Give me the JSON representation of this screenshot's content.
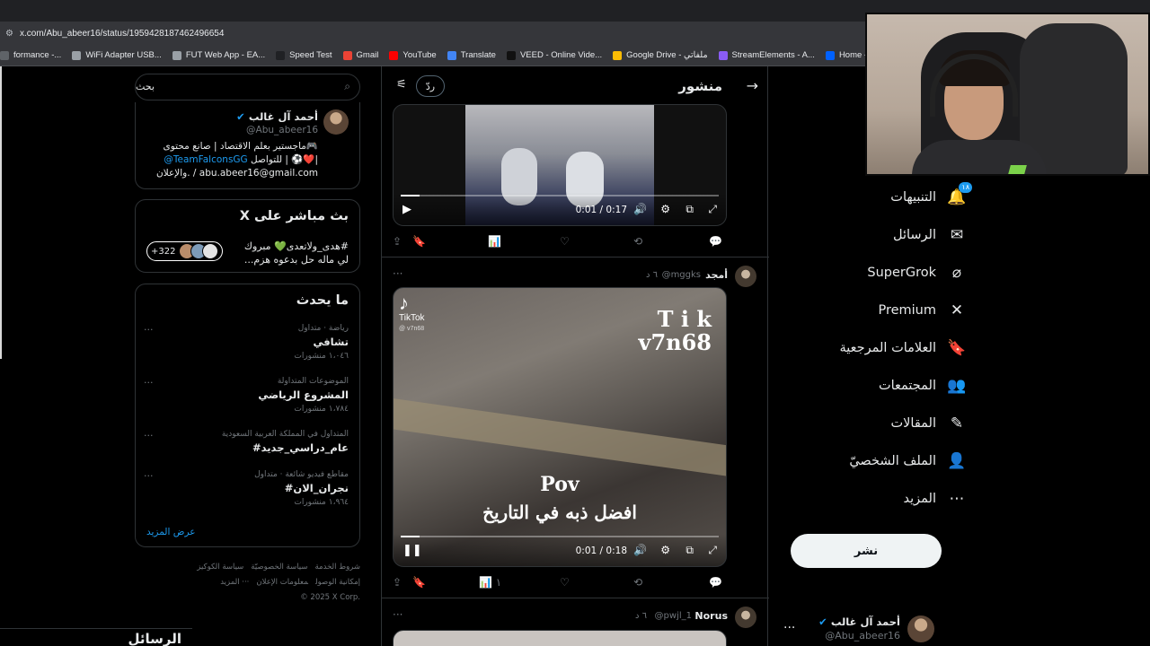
{
  "browser": {
    "url": "x.com/Abu_abeer16/status/1959428187462496654",
    "bookmarks": [
      {
        "label": "formance -...",
        "color": "#5f6368"
      },
      {
        "label": "WiFi Adapter USB...",
        "color": "#9aa0a6"
      },
      {
        "label": "FUT Web App - EA...",
        "color": "#9aa0a6"
      },
      {
        "label": "Speed Test",
        "color": "#202124"
      },
      {
        "label": "Gmail",
        "color": "#ea4335"
      },
      {
        "label": "YouTube",
        "color": "#ff0000"
      },
      {
        "label": "Translate",
        "color": "#4285f4"
      },
      {
        "label": "VEED - Online Vide...",
        "color": "#111111"
      },
      {
        "label": "Google Drive - ملفاتي",
        "color": "#fbbc04"
      },
      {
        "label": "StreamElements - A...",
        "color": "#8a5cf6"
      },
      {
        "label": "Home - Dropbox",
        "color": "#0061ff"
      }
    ]
  },
  "nav": {
    "items": [
      {
        "label": "التنبيهات",
        "icon": "bell-icon",
        "glyph": "🔔"
      },
      {
        "label": "الرسائل",
        "icon": "envelope-icon",
        "glyph": "✉"
      },
      {
        "label": "SuperGrok",
        "icon": "grok-icon",
        "glyph": "⌀"
      },
      {
        "label": "Premium",
        "icon": "x-logo-icon",
        "glyph": "✕"
      },
      {
        "label": "العلامات المرجعية",
        "icon": "bookmark-icon",
        "glyph": "🔖"
      },
      {
        "label": "المجتمعات",
        "icon": "communities-icon",
        "glyph": "👥"
      },
      {
        "label": "المقالات",
        "icon": "articles-icon",
        "glyph": "✎"
      },
      {
        "label": "الملف الشخصيّ",
        "icon": "profile-icon",
        "glyph": "👤"
      },
      {
        "label": "المزيد",
        "icon": "more-circle-icon",
        "glyph": "⋯"
      }
    ],
    "notification_badge": "١٨",
    "post_button": "نشر"
  },
  "account": {
    "name": "أحمد آل غالب",
    "handle": "@Abu_abeer16"
  },
  "timeline": {
    "header_title": "منشور",
    "reply_button": "ردّ",
    "video1": {
      "time": "0:01 / 0:17",
      "progress": 0.06
    },
    "post2": {
      "author": "أمجد",
      "handle": "@mggks",
      "ago": "٦ د",
      "tiktok_label": "TikTok",
      "tiktok_user": "@ v7n68",
      "overlay_title_1": "T i k",
      "overlay_title_2": "v7n68",
      "caption_1": "Pov",
      "caption_2": "افضل ذبه في التاريخ",
      "video_time": "0:01 / 0:18",
      "progress": 0.06,
      "views": "١"
    },
    "post3": {
      "author": "Norus",
      "handle": "@pwjl_1",
      "ago": "٦ د"
    }
  },
  "sidebar": {
    "search_text": "بحث",
    "profile": {
      "name": "أحمد آل غالب",
      "handle": "@Abu_abeer16",
      "bio_1": "ماجستير بعلم الاقتصاد | صانع محتوى🎮",
      "bio_2_link": "@TeamFalconsGG",
      "bio_2_rest": "للتواصل | ⚽❤️|",
      "bio_3": "والإعلان. / abu.abeer16@gmail.com"
    },
    "live": {
      "title": "X بث مباشر على",
      "line_1": "هدى_ولاتعدى💚 مبروك#",
      "line_2": "...لي ماله حل بدعوه هزم",
      "count": "+322"
    },
    "trends": {
      "title": "ما يحدث",
      "items": [
        {
          "category": "رياضة · متداول",
          "name": "تشافي",
          "count": "١،٠٤٦ منشورات"
        },
        {
          "category": "الموضوعات المتداولة",
          "name": "المشروع الرياضي",
          "count": "١،٧٨٤ منشورات"
        },
        {
          "category": "المتداول في المملكة العربية السعودية",
          "name": "#عام_دراسي_جديد",
          "count": ""
        },
        {
          "category": "مقاطع فيديو شائعة · متداول",
          "name": "#نجران_الان",
          "count": "١،٩٦٤ منشورات"
        }
      ],
      "show_more": "عرض المزيد"
    },
    "footer": {
      "line_1": [
        "شروط الخدمة",
        "سياسة الخصوصيّة",
        "سياسة الكوكيز"
      ],
      "line_2": [
        "إمكانية الوصول",
        "معلومات الإعلان",
        "··· المزيد"
      ],
      "line_3": "© 2025 X Corp."
    },
    "messages_dock": "الرسائل"
  }
}
